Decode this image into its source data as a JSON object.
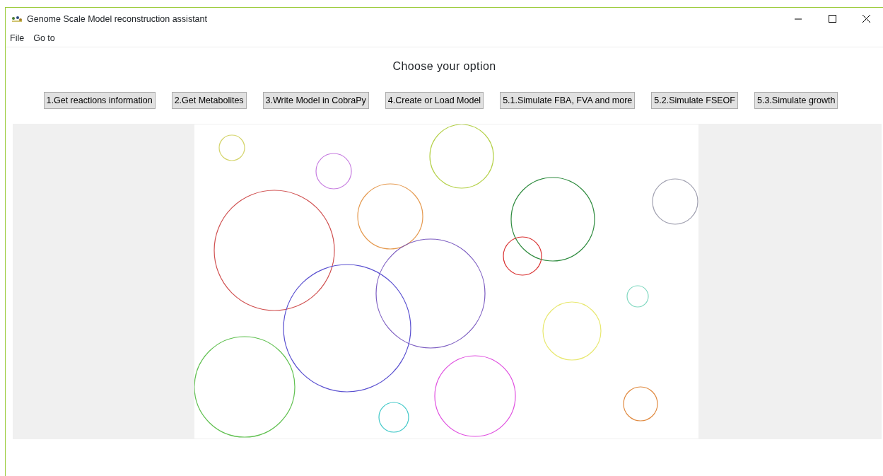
{
  "window": {
    "title": "Genome Scale Model reconstruction assistant"
  },
  "menu": [
    "File",
    "Go to"
  ],
  "heading": "Choose your option",
  "buttons": [
    "1.Get reactions information",
    "2.Get Metabolites",
    "3.Write Model in CobraPy",
    "4.Create or Load Model",
    "5.1.Simulate FBA, FVA and more",
    "5.2.Simulate FSEOF",
    "5.3.Simulate growth"
  ]
}
